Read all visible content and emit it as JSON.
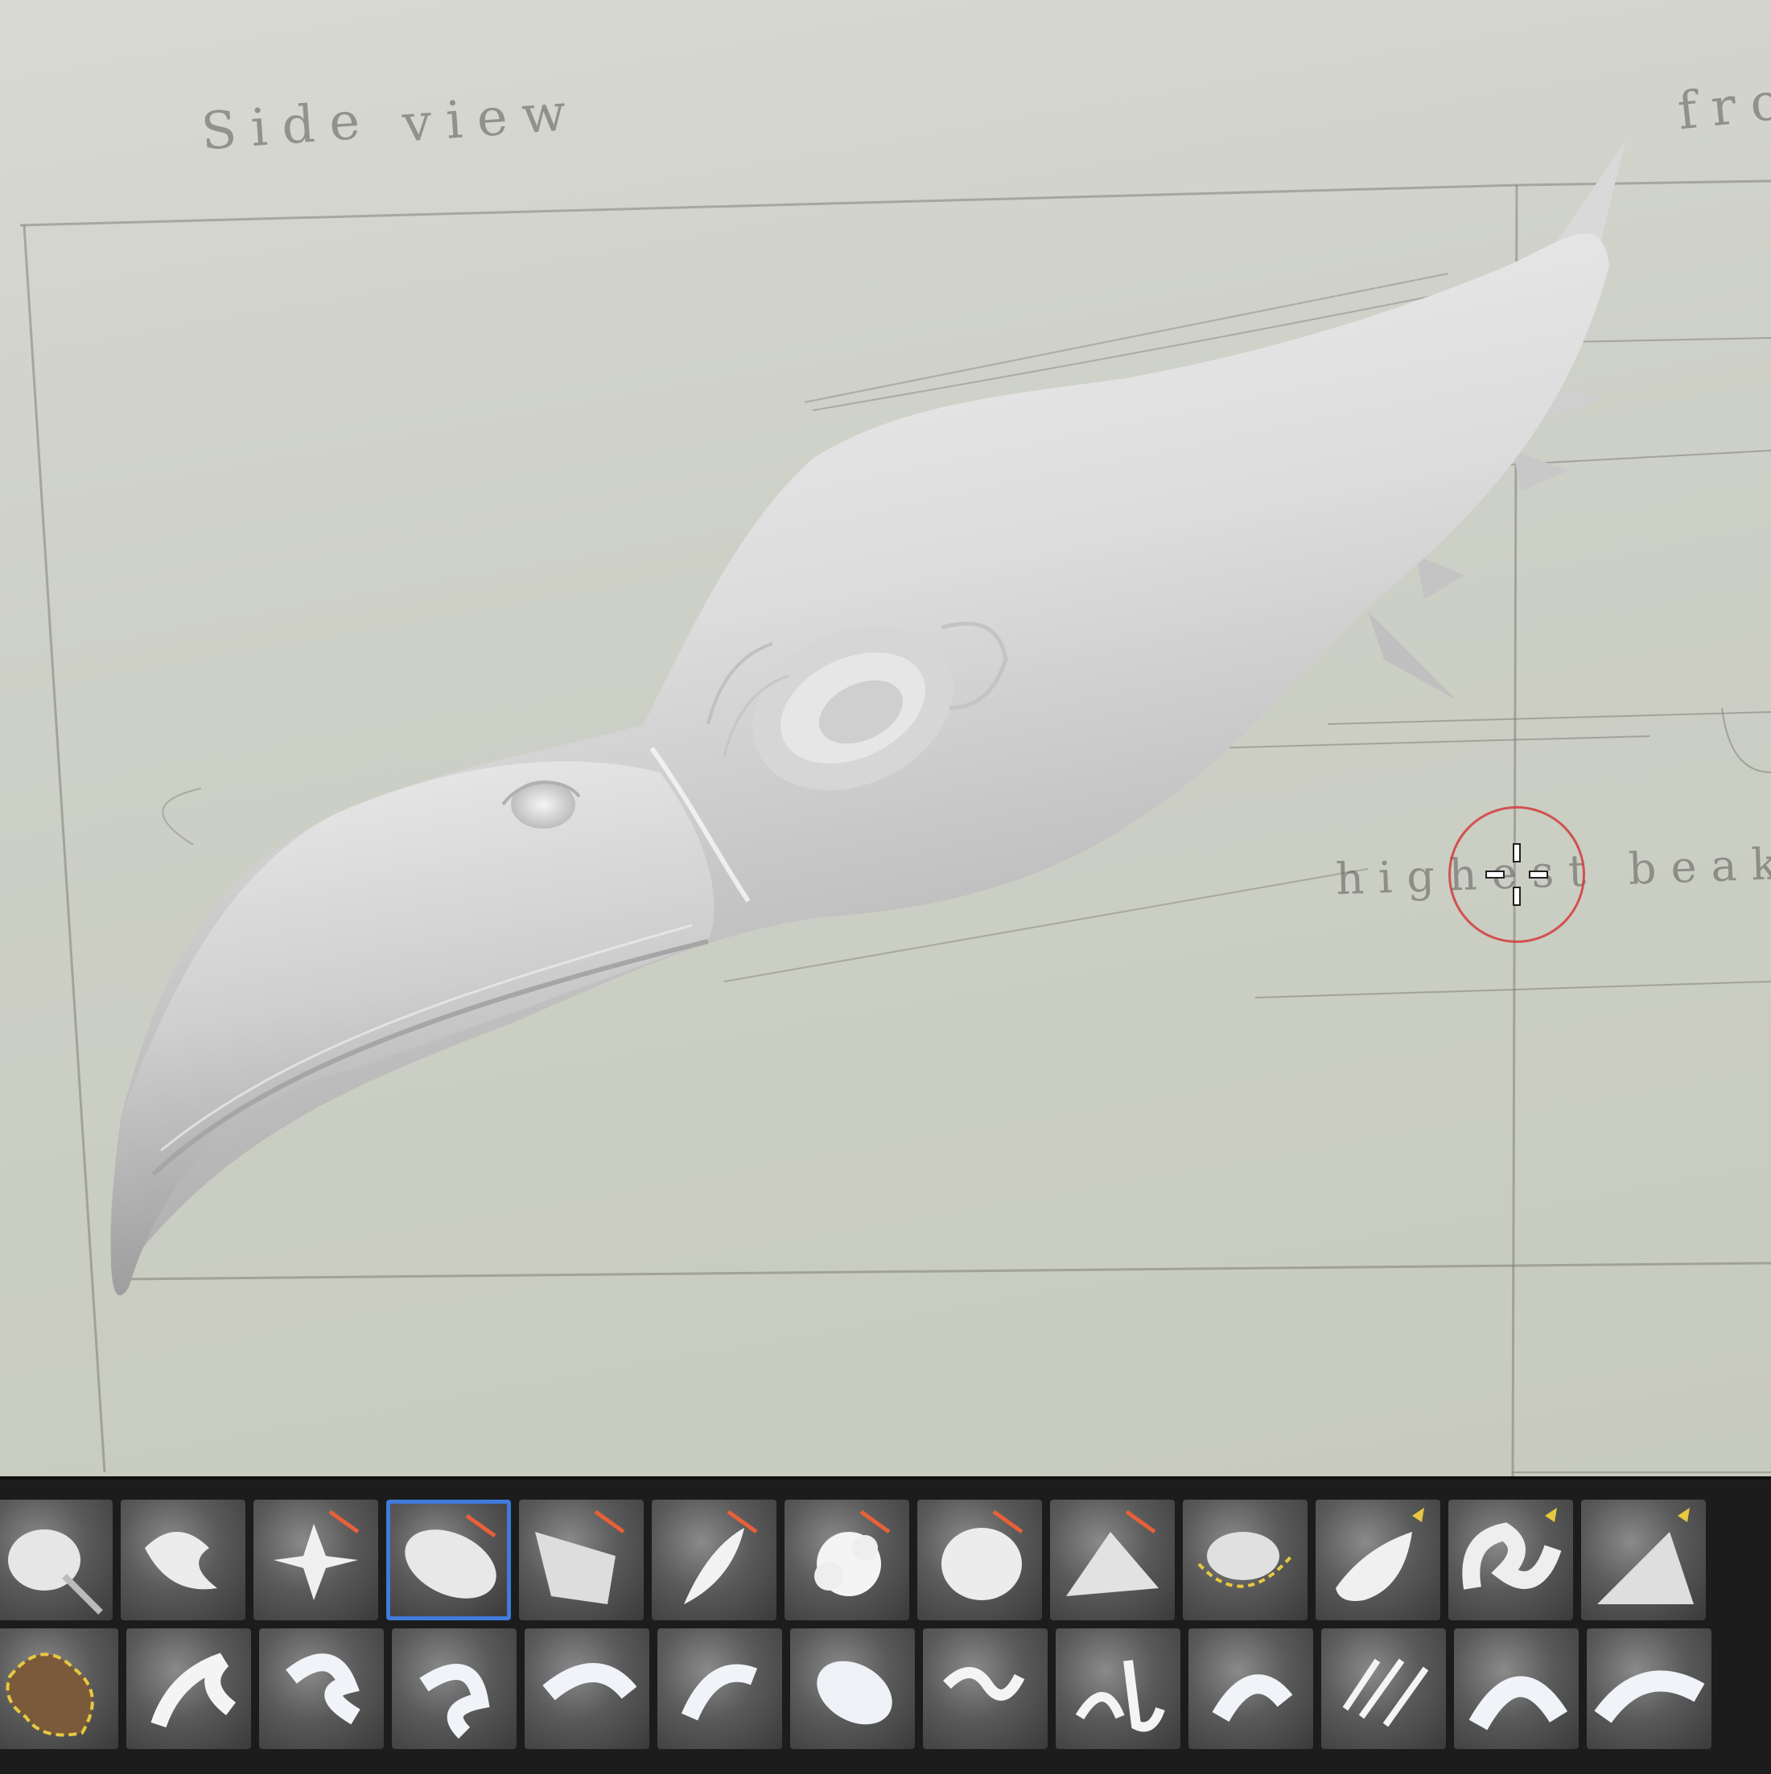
{
  "sketch": {
    "side_label_1": "Side",
    "side_label_2": "view",
    "front_label": "fro",
    "annotation": "highest beak p"
  },
  "brush_palette": {
    "selected_index": 3,
    "row_1": [
      {
        "icon": "standard-brush-icon"
      },
      {
        "icon": "move-brush-icon"
      },
      {
        "icon": "pinch-star-brush-icon"
      },
      {
        "icon": "flatten-brush-icon"
      },
      {
        "icon": "trim-brush-icon"
      },
      {
        "icon": "clay-tubes-brush-icon"
      },
      {
        "icon": "noise-brush-icon"
      },
      {
        "icon": "clay-buildup-brush-icon"
      },
      {
        "icon": "polish-brush-icon"
      },
      {
        "icon": "inflate-brush-icon"
      },
      {
        "icon": "curve-brush-icon"
      },
      {
        "icon": "snake-hook-brush-icon"
      },
      {
        "icon": "move-topological-brush-icon"
      }
    ],
    "row_2": [
      {
        "icon": "mask-lasso-brush-icon"
      },
      {
        "icon": "alpha-brush-1-icon"
      },
      {
        "icon": "alpha-brush-2-icon"
      },
      {
        "icon": "alpha-brush-3-icon"
      },
      {
        "icon": "alpha-brush-4-icon"
      },
      {
        "icon": "alpha-brush-5-icon"
      },
      {
        "icon": "alpha-brush-6-icon"
      },
      {
        "icon": "alpha-brush-7-icon"
      },
      {
        "icon": "alpha-brush-8-icon"
      },
      {
        "icon": "alpha-brush-9-icon"
      },
      {
        "icon": "alpha-brush-10-icon"
      },
      {
        "icon": "alpha-brush-11-icon"
      },
      {
        "icon": "alpha-brush-12-icon"
      }
    ]
  },
  "colors": {
    "accent_selection": "#3f7bdc",
    "brush_marker": "#e8603a",
    "cursor_ring": "#d23c3c",
    "brush_highlight": "#e8c840"
  }
}
